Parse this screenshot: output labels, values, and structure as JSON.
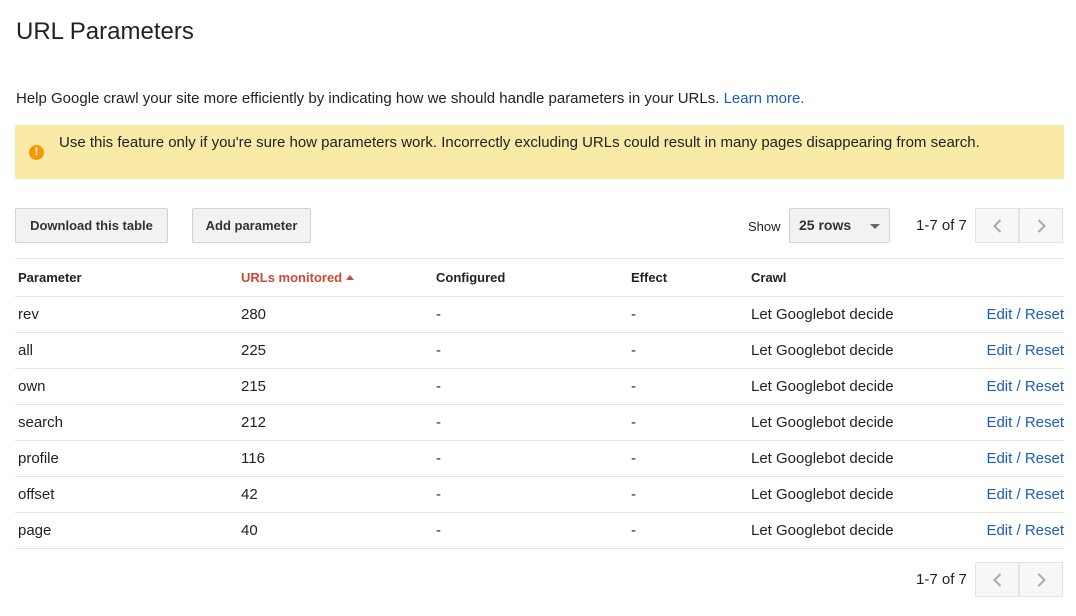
{
  "page": {
    "title": "URL Parameters"
  },
  "help": {
    "text": "Help Google crawl your site more efficiently by indicating how we should handle parameters in your URLs.",
    "learn_more": "Learn more."
  },
  "warning": {
    "icon": "!",
    "text": "Use this feature only if you're sure how parameters work. Incorrectly excluding URLs could result in many pages disappearing from search."
  },
  "toolbar": {
    "download_label": "Download this table",
    "add_label": "Add parameter",
    "show_label": "Show",
    "rows_value": "25 rows",
    "pager_text": "1-7 of 7"
  },
  "table": {
    "columns": {
      "parameter": "Parameter",
      "urls_monitored": "URLs monitored",
      "configured": "Configured",
      "effect": "Effect",
      "crawl": "Crawl"
    },
    "rows": [
      {
        "parameter": "rev",
        "urls": "280",
        "configured": "-",
        "effect": "-",
        "crawl": "Let Googlebot decide",
        "edit": "Edit",
        "sep": "/",
        "reset": "Reset"
      },
      {
        "parameter": "all",
        "urls": "225",
        "configured": "-",
        "effect": "-",
        "crawl": "Let Googlebot decide",
        "edit": "Edit",
        "sep": "/",
        "reset": "Reset"
      },
      {
        "parameter": "own",
        "urls": "215",
        "configured": "-",
        "effect": "-",
        "crawl": "Let Googlebot decide",
        "edit": "Edit",
        "sep": "/",
        "reset": "Reset"
      },
      {
        "parameter": "search",
        "urls": "212",
        "configured": "-",
        "effect": "-",
        "crawl": "Let Googlebot decide",
        "edit": "Edit",
        "sep": "/",
        "reset": "Reset"
      },
      {
        "parameter": "profile",
        "urls": "116",
        "configured": "-",
        "effect": "-",
        "crawl": "Let Googlebot decide",
        "edit": "Edit",
        "sep": "/",
        "reset": "Reset"
      },
      {
        "parameter": "offset",
        "urls": "42",
        "configured": "-",
        "effect": "-",
        "crawl": "Let Googlebot decide",
        "edit": "Edit",
        "sep": "/",
        "reset": "Reset"
      },
      {
        "parameter": "page",
        "urls": "40",
        "configured": "-",
        "effect": "-",
        "crawl": "Let Googlebot decide",
        "edit": "Edit",
        "sep": "/",
        "reset": "Reset"
      }
    ]
  },
  "footer": {
    "pager_text": "1-7 of 7"
  },
  "colors": {
    "link": "#1a5bc4",
    "sorted_header": "#d14836",
    "warning_bg": "#faeaa8",
    "warning_icon": "#f29a00"
  },
  "icons": {
    "warning": "warning-icon",
    "sort": "sort-ascending-icon",
    "prev": "chevron-left-icon",
    "next": "chevron-right-icon",
    "dropdown": "caret-down-icon"
  }
}
